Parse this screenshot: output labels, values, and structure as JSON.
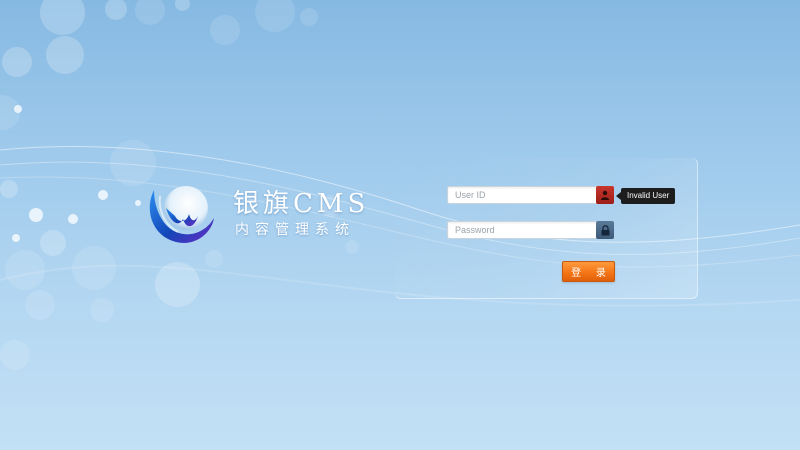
{
  "brand": {
    "title": "银旗CMS",
    "subtitle": "内容管理系统",
    "logo_icon": "swirl-globe-logo"
  },
  "form": {
    "user_id_placeholder": "User ID",
    "user_id_value": "",
    "user_icon": "user-icon",
    "user_icon_color": "#b82a22",
    "password_placeholder": "Password",
    "password_value": "",
    "lock_icon": "lock-icon",
    "lock_icon_color": "#4a6a8a",
    "validation_message": "Invalid User",
    "submit_label": "登 录",
    "submit_color": "#f47617"
  }
}
